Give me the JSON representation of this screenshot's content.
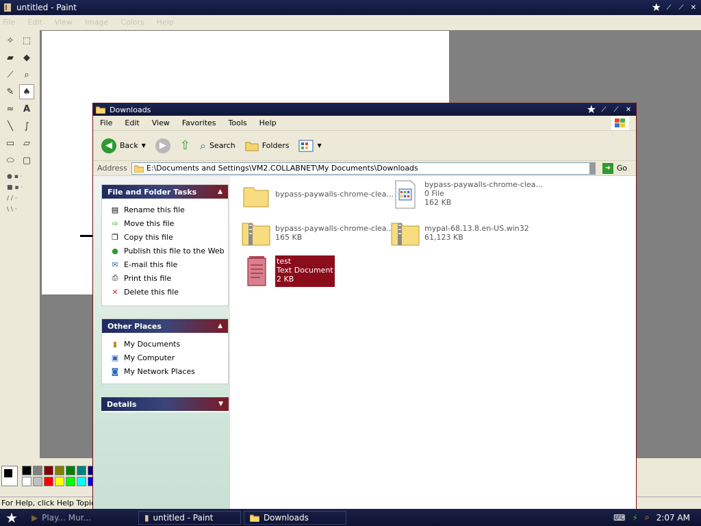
{
  "paint": {
    "title": "untitled - Paint",
    "menu": [
      "File",
      "Edit",
      "View",
      "Image",
      "Colors",
      "Help"
    ],
    "status": "For Help, click Help Topics on the Help Menu."
  },
  "explorer": {
    "title": "Downloads",
    "menu": [
      "File",
      "Edit",
      "View",
      "Favorites",
      "Tools",
      "Help"
    ],
    "toolbar": {
      "back": "Back",
      "search": "Search",
      "folders": "Folders"
    },
    "address": {
      "label": "Address",
      "value": "E:\\Documents and Settings\\VM2.COLLABNET\\My Documents\\Downloads",
      "go": "Go"
    },
    "tasks": {
      "title": "File and Folder Tasks",
      "items": [
        "Rename this file",
        "Move this file",
        "Copy this file",
        "Publish this file to the Web",
        "E-mail this file",
        "Print this file",
        "Delete this file"
      ]
    },
    "places": {
      "title": "Other Places",
      "items": [
        "My Documents",
        "My Computer",
        "My Network Places"
      ]
    },
    "details": {
      "title": "Details"
    },
    "files": [
      {
        "name": "bypass-paywalls-chrome-clea...",
        "line2": "",
        "line3": ""
      },
      {
        "name": "bypass-paywalls-chrome-clea...",
        "line2": "0 File",
        "line3": "162 KB"
      },
      {
        "name": "bypass-paywalls-chrome-clea...",
        "line2": "165 KB",
        "line3": ""
      },
      {
        "name": "mypal-68.13.8.en-US.win32",
        "line2": "61,123 KB",
        "line3": ""
      },
      {
        "name": "test",
        "line2": "Text Document",
        "line3": "2 KB"
      }
    ]
  },
  "taskbar": {
    "tasks": [
      "Play... Mur...",
      "untitled - Paint",
      "Downloads"
    ],
    "clock": "2:07 AM"
  },
  "colors": {
    "title_bg": "#1c2452",
    "selection": "#8b0d1c"
  }
}
